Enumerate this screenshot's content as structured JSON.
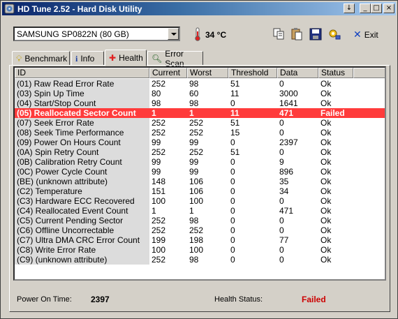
{
  "window": {
    "title": "HD Tune 2.52 - Hard Disk Utility"
  },
  "toolbar": {
    "drive": "SAMSUNG SP0822N (80 GB)",
    "temperature": "34 °C",
    "exit_label": "Exit"
  },
  "tabs": [
    {
      "label": "Benchmark",
      "icon": "lightbulb-icon"
    },
    {
      "label": "Info",
      "icon": "info-icon"
    },
    {
      "label": "Health",
      "icon": "red-cross-icon"
    },
    {
      "label": "Error Scan",
      "icon": "magnifier-icon"
    }
  ],
  "table": {
    "headers": [
      "ID",
      "Current",
      "Worst",
      "Threshold",
      "Data",
      "Status"
    ],
    "rows": [
      [
        "(01) Raw Read Error Rate",
        "252",
        "98",
        "51",
        "0",
        "Ok"
      ],
      [
        "(03) Spin Up Time",
        "80",
        "60",
        "11",
        "3000",
        "Ok"
      ],
      [
        "(04) Start/Stop Count",
        "98",
        "98",
        "0",
        "1641",
        "Ok"
      ],
      [
        "(05) Reallocated Sector Count",
        "1",
        "1",
        "11",
        "471",
        "Failed"
      ],
      [
        "(07) Seek Error Rate",
        "252",
        "252",
        "51",
        "0",
        "Ok"
      ],
      [
        "(08) Seek Time Performance",
        "252",
        "252",
        "15",
        "0",
        "Ok"
      ],
      [
        "(09) Power On Hours Count",
        "99",
        "99",
        "0",
        "2397",
        "Ok"
      ],
      [
        "(0A) Spin Retry Count",
        "252",
        "252",
        "51",
        "0",
        "Ok"
      ],
      [
        "(0B) Calibration Retry Count",
        "99",
        "99",
        "0",
        "9",
        "Ok"
      ],
      [
        "(0C) Power Cycle Count",
        "99",
        "99",
        "0",
        "896",
        "Ok"
      ],
      [
        "(BE) (unknown attribute)",
        "148",
        "106",
        "0",
        "35",
        "Ok"
      ],
      [
        "(C2) Temperature",
        "151",
        "106",
        "0",
        "34",
        "Ok"
      ],
      [
        "(C3) Hardware ECC Recovered",
        "100",
        "100",
        "0",
        "0",
        "Ok"
      ],
      [
        "(C4) Reallocated Event Count",
        "1",
        "1",
        "0",
        "471",
        "Ok"
      ],
      [
        "(C5) Current Pending Sector",
        "252",
        "98",
        "0",
        "0",
        "Ok"
      ],
      [
        "(C6) Offline Uncorrectable",
        "252",
        "252",
        "0",
        "0",
        "Ok"
      ],
      [
        "(C7) Ultra DMA CRC Error Count",
        "199",
        "198",
        "0",
        "77",
        "Ok"
      ],
      [
        "(C8) Write Error Rate",
        "100",
        "100",
        "0",
        "0",
        "Ok"
      ],
      [
        "(C9) (unknown attribute)",
        "252",
        "98",
        "0",
        "0",
        "Ok"
      ]
    ],
    "failed_row_index": 3
  },
  "status": {
    "power_on_label": "Power On Time:",
    "power_on_value": "2397",
    "health_label": "Health Status:",
    "health_value": "Failed",
    "health_color": "#cc0000"
  },
  "colors": {
    "title_start": "#0a246a",
    "failed_row": "#ff3b3b",
    "face": "#d4d0c8"
  }
}
